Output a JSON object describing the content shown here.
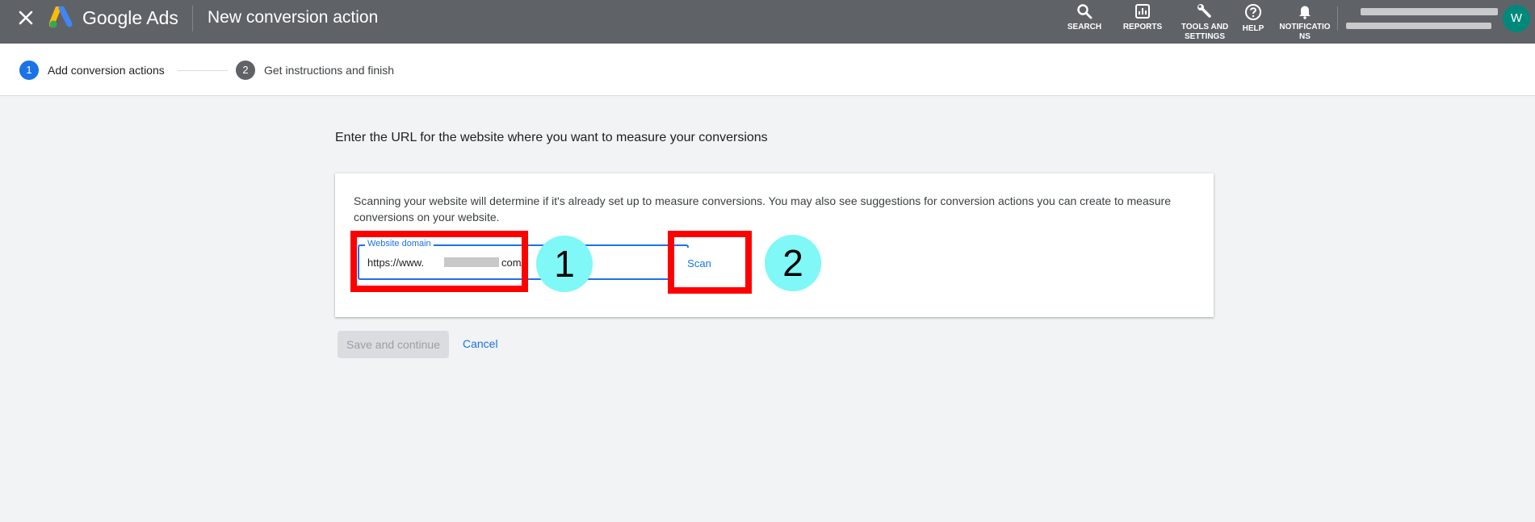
{
  "header": {
    "product_name": "Google Ads",
    "page_title": "New conversion action",
    "nav": {
      "search": "SEARCH",
      "reports": "REPORTS",
      "tools_line1": "TOOLS AND",
      "tools_line2": "SETTINGS",
      "help": "HELP",
      "notif_line1": "NOTIFICATIO",
      "notif_line2": "NS"
    },
    "avatar_letter": "W"
  },
  "stepper": {
    "steps": [
      {
        "number": "1",
        "label": "Add conversion actions",
        "state": "active"
      },
      {
        "number": "2",
        "label": "Get instructions and finish",
        "state": "inactive"
      }
    ]
  },
  "main": {
    "heading": "Enter the URL for the website where you want to measure your conversions",
    "description": "Scanning your website will determine if it's already set up to measure conversions. You may also see suggestions for conversion actions you can create to measure conversions on your website.",
    "domain_field": {
      "label": "Website domain",
      "value_prefix": "https://www.",
      "value_suffix": "com/"
    },
    "scan_label": "Scan",
    "save_label": "Save and continue",
    "cancel_label": "Cancel"
  },
  "annotations": {
    "marker1": "1",
    "marker2": "2"
  },
  "colors": {
    "topbar": "#5f6368",
    "accent": "#1a73e8",
    "highlight": "#ff0000",
    "bubble": "#7ff8f7",
    "avatar": "#00897b"
  },
  "icons": [
    "close-icon",
    "google-ads-logo",
    "search-icon",
    "reports-icon",
    "wrench-icon",
    "help-icon",
    "bell-icon"
  ]
}
